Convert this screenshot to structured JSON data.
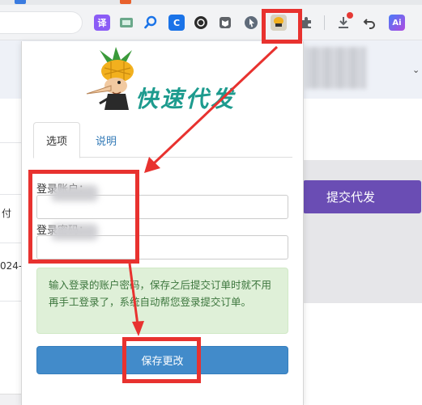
{
  "browser": {
    "extensions": [
      {
        "name": "translate-icon",
        "label": "译",
        "color": "#8b5cf6"
      },
      {
        "name": "screenshot-icon",
        "label": "",
        "color": "#6aa88a"
      },
      {
        "name": "search-icon",
        "label": "",
        "color": "#ffffff"
      },
      {
        "name": "c-extension-icon",
        "label": "C",
        "color": "#1a73e8"
      },
      {
        "name": "dark-circle-icon",
        "label": "",
        "color": "#2b2b2b"
      },
      {
        "name": "reader-icon",
        "label": "",
        "color": "#5f6368"
      },
      {
        "name": "cursor-icon",
        "label": "",
        "color": "#5f6b7a"
      },
      {
        "name": "dark-square-icon",
        "label": "",
        "color": "#333333"
      },
      {
        "name": "quick-order-extension-icon",
        "label": "",
        "color": "#e9e4d6"
      },
      {
        "name": "puzzle-icon",
        "label": "",
        "color": "#5f6368"
      },
      {
        "name": "download-icon",
        "label": "",
        "color": "#5f6368"
      },
      {
        "name": "back-icon",
        "label": "",
        "color": "#5f6368"
      },
      {
        "name": "ai-assistant-icon",
        "label": "Ai",
        "color": "#4a7bf7"
      }
    ]
  },
  "page": {
    "submit_button": "提交代发",
    "left_fragment_1": "付",
    "left_fragment_2": "024-",
    "caret": "⌄"
  },
  "popup": {
    "logo_text": "快速代发",
    "tabs": [
      {
        "label": "选项",
        "active": true
      },
      {
        "label": "说明",
        "active": false
      }
    ],
    "account_label": "登录账户：",
    "password_label": "登录密码：",
    "account_value": "",
    "password_value": "",
    "notice": "输入登录的账户密码，保存之后提交订单时就不用再手工登录了，系统自动帮您登录提交订单。",
    "save_button": "保存更改"
  },
  "colors": {
    "annotation_red": "#e8322f",
    "submit_purple": "#6a4db4",
    "save_blue": "#428bca",
    "notice_green_bg": "#dff0d8"
  }
}
